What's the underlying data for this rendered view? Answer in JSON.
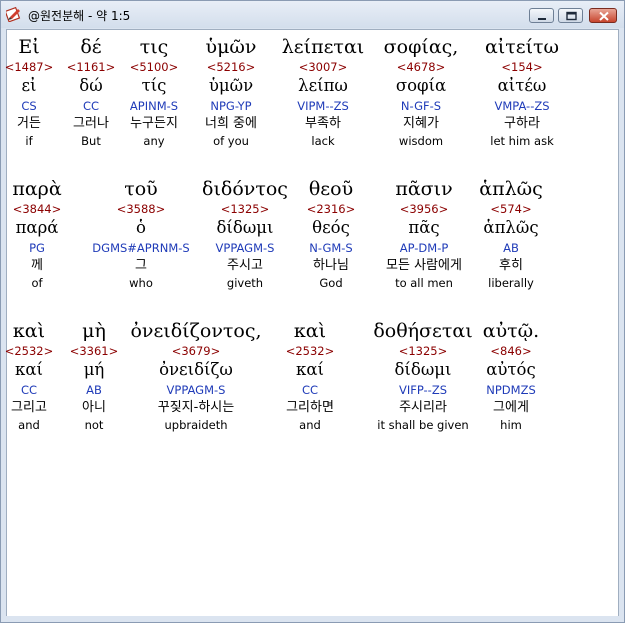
{
  "window": {
    "title": "@원전분해 - 약 1:5"
  },
  "icons": [
    "app-icon",
    "minimize-icon",
    "maximize-icon",
    "close-icon"
  ],
  "rows": [
    [
      {
        "greek": "Εἰ",
        "num": "<1487>",
        "lemma": "εἰ",
        "parse": "CS",
        "korean": "거든",
        "english": "if"
      },
      {
        "greek": "δέ",
        "num": "<1161>",
        "lemma": "δώ",
        "parse": "CC",
        "korean": "그러나",
        "english": "But"
      },
      {
        "greek": "τις",
        "num": "<5100>",
        "lemma": "τίς",
        "parse": "APINM-S",
        "korean": "누구든지",
        "english": "any"
      },
      {
        "greek": "ὑμῶν",
        "num": "<5216>",
        "lemma": "ὑμῶν",
        "parse": "NPG-YP",
        "korean": "너희 중에",
        "english": "of you"
      },
      {
        "greek": "λείπεται",
        "num": "<3007>",
        "lemma": "λείπω",
        "parse": "VIPM--ZS",
        "korean": "부족하",
        "english": "lack"
      },
      {
        "greek": "σοφίας,",
        "num": "<4678>",
        "lemma": "σοφία",
        "parse": "N-GF-S",
        "korean": "지혜가",
        "english": "wisdom"
      },
      {
        "greek": "αἰτείτω",
        "num": "<154>",
        "lemma": "αἰτέω",
        "parse": "VMPA--ZS",
        "korean": "구하라",
        "english": "let him ask"
      }
    ],
    [
      {
        "greek": "παρὰ",
        "num": "<3844>",
        "lemma": "παρά",
        "parse": "PG",
        "korean": "께",
        "english": "of"
      },
      {
        "greek": "τοῦ",
        "num": "<3588>",
        "lemma": "ὁ",
        "parse": "DGMS#APRNM-S",
        "korean": "그",
        "english": "who"
      },
      {
        "greek": "διδόντος",
        "num": "<1325>",
        "lemma": "δίδωμι",
        "parse": "VPPAGM-S",
        "korean": "주시고",
        "english": "giveth"
      },
      {
        "greek": "θεοῦ",
        "num": "<2316>",
        "lemma": "θεός",
        "parse": "N-GM-S",
        "korean": "하나님",
        "english": "God"
      },
      {
        "greek": "πᾶσιν",
        "num": "<3956>",
        "lemma": "πᾶς",
        "parse": "AP-DM-P",
        "korean": "모든 사람에게",
        "english": "to all men"
      },
      {
        "greek": "ἁπλῶς",
        "num": "<574>",
        "lemma": "ἁπλῶς",
        "parse": "AB",
        "korean": "후히",
        "english": "liberally"
      }
    ],
    [
      {
        "greek": "καὶ",
        "num": "<2532>",
        "lemma": "καί",
        "parse": "CC",
        "korean": "그리고",
        "english": "and"
      },
      {
        "greek": "μὴ",
        "num": "<3361>",
        "lemma": "μή",
        "parse": "AB",
        "korean": "아니",
        "english": "not"
      },
      {
        "greek": "ὀνειδίζοντος,",
        "num": "<3679>",
        "lemma": "ὀνειδίζω",
        "parse": "VPPAGM-S",
        "korean": "꾸짖지-하시는",
        "english": "upbraideth"
      },
      {
        "greek": "καὶ",
        "num": "<2532>",
        "lemma": "καί",
        "parse": "CC",
        "korean": "그리하면",
        "english": "and"
      },
      {
        "greek": "δοθήσεται",
        "num": "<1325>",
        "lemma": "δίδωμι",
        "parse": "VIFP--ZS",
        "korean": "주시리라",
        "english": "it shall be given"
      },
      {
        "greek": "αὐτῷ.",
        "num": "<846>",
        "lemma": "αὐτός",
        "parse": "NPDMZS",
        "korean": "그에게",
        "english": "him"
      }
    ]
  ]
}
